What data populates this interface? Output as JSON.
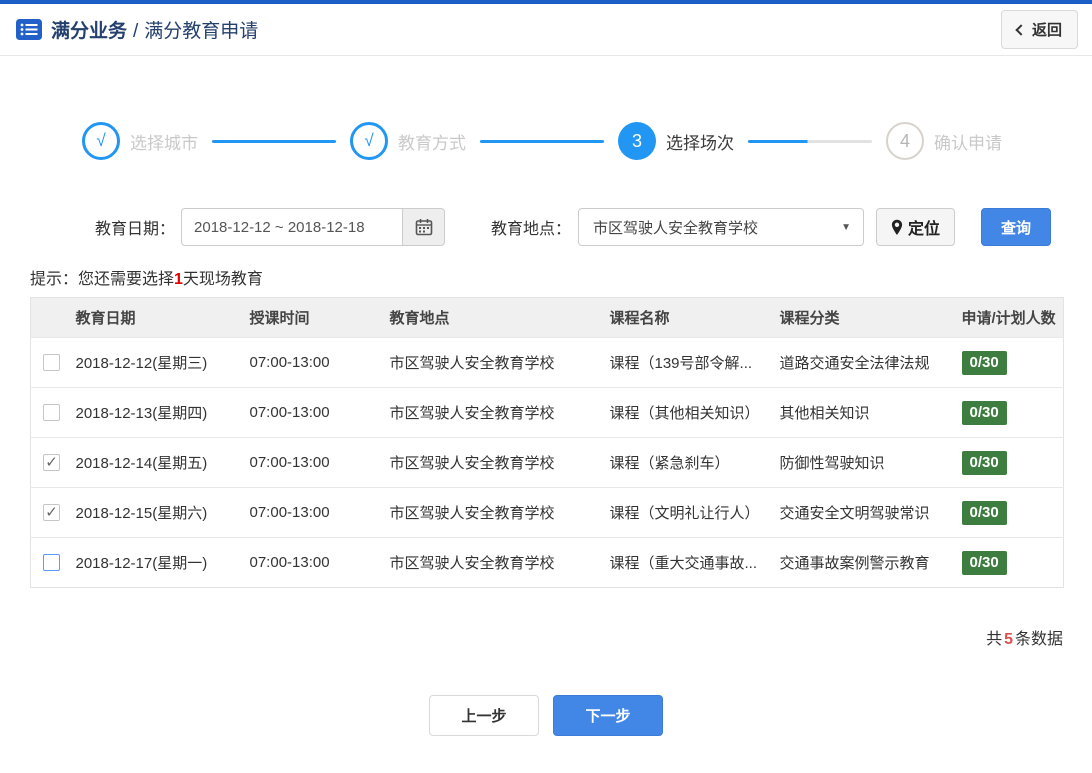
{
  "colors": {
    "accent_blue": "#4387e6",
    "stepper_blue": "#2196f3",
    "top_strip_blue": "#1b5ec6",
    "badge_green": "#3d7e40",
    "alert_red": "#e60000",
    "count_red": "#d9534f",
    "title_navy": "#24406e"
  },
  "header": {
    "icon": "list-icon",
    "crumb_section": "满分业务",
    "crumb_sep": "/",
    "crumb_page": "满分教育申请",
    "back_label": "返回"
  },
  "stepper": {
    "steps": [
      {
        "mark": "√",
        "label": "选择城市",
        "state": "done"
      },
      {
        "mark": "√",
        "label": "教育方式",
        "state": "done"
      },
      {
        "mark": "3",
        "label": "选择场次",
        "state": "active"
      },
      {
        "mark": "4",
        "label": "确认申请",
        "state": "pending"
      }
    ]
  },
  "filters": {
    "date_label": "教育日期：",
    "date_value": "2018-12-12 ~ 2018-12-18",
    "calendar_icon": "calendar-icon",
    "location_label": "教育地点：",
    "location_value": "市区驾驶人安全教育学校",
    "dropdown_arrow": "▼",
    "locate_icon": "map-pin-icon",
    "locate_label": "定位",
    "search_label": "查询"
  },
  "hint": {
    "prefix": "提示：您还需要选择",
    "highlight": "1",
    "suffix": "天现场教育"
  },
  "table": {
    "headers": [
      "教育日期",
      "授课时间",
      "教育地点",
      "课程名称",
      "课程分类",
      "申请/计划人数"
    ],
    "rows": [
      {
        "check": "",
        "date": "2018-12-12(星期三)",
        "time": "07:00-13:00",
        "place": "市区驾驶人安全教育学校",
        "course": "课程（139号部令解...",
        "category": "道路交通安全法律法规",
        "quota": "0/30"
      },
      {
        "check": "",
        "date": "2018-12-13(星期四)",
        "time": "07:00-13:00",
        "place": "市区驾驶人安全教育学校",
        "course": "课程（其他相关知识）",
        "category": "其他相关知识",
        "quota": "0/30"
      },
      {
        "check": "✓",
        "date": "2018-12-14(星期五)",
        "time": "07:00-13:00",
        "place": "市区驾驶人安全教育学校",
        "course": "课程（紧急刹车）",
        "category": "防御性驾驶知识",
        "quota": "0/30"
      },
      {
        "check": "✓",
        "date": "2018-12-15(星期六)",
        "time": "07:00-13:00",
        "place": "市区驾驶人安全教育学校",
        "course": "课程（文明礼让行人）",
        "category": "交通安全文明驾驶常识",
        "quota": "0/30"
      },
      {
        "check": "",
        "date": "2018-12-17(星期一)",
        "time": "07:00-13:00",
        "place": "市区驾驶人安全教育学校",
        "course": "课程（重大交通事故...",
        "category": "交通事故案例警示教育",
        "quota": "0/30"
      }
    ]
  },
  "footer": {
    "total_prefix": "共",
    "total_count": "5",
    "total_suffix": "条数据"
  },
  "actions": {
    "prev_label": "上一步",
    "next_label": "下一步"
  }
}
